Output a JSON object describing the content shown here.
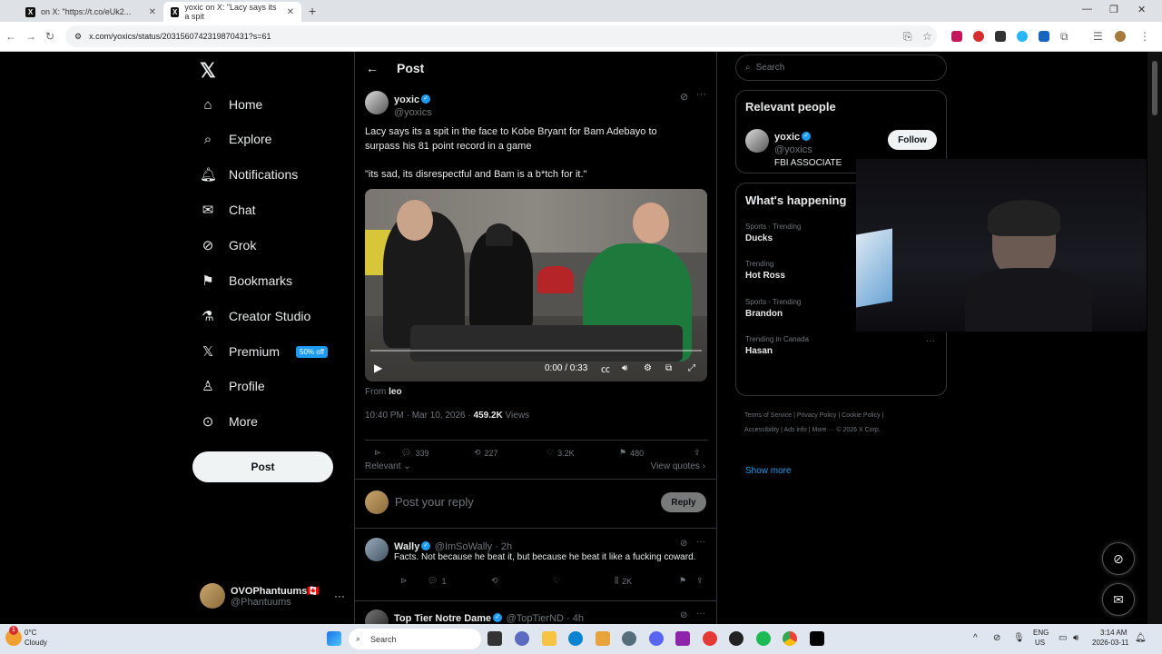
{
  "browser": {
    "tabs": [
      {
        "label": "on X: \"https://t.co/eUk2..."
      },
      {
        "label": "yoxic on X: \"Lacy says its a spit"
      }
    ],
    "url": "x.com/yoxics/status/2031560742319870431?s=61"
  },
  "sidebar": {
    "items": [
      {
        "label": "Home",
        "icon": "home-icon"
      },
      {
        "label": "Explore",
        "icon": "search-icon"
      },
      {
        "label": "Notifications",
        "icon": "bell-icon"
      },
      {
        "label": "Chat",
        "icon": "mail-icon"
      },
      {
        "label": "Grok",
        "icon": "grok-icon"
      },
      {
        "label": "Bookmarks",
        "icon": "bookmark-icon"
      },
      {
        "label": "Creator Studio",
        "icon": "flask-icon"
      },
      {
        "label": "Premium",
        "icon": "x-logo-icon",
        "badge": "50% off"
      },
      {
        "label": "Profile",
        "icon": "person-icon"
      },
      {
        "label": "More",
        "icon": "more-circle-icon"
      }
    ],
    "post_label": "Post",
    "account": {
      "name": "OVOPhantuums🇨🇦",
      "handle": "@Phantuums"
    }
  },
  "main": {
    "header_title": "Post",
    "tweet": {
      "name": "yoxic",
      "handle": "@yoxics",
      "text_line1": "Lacy says its a spit in the face to Kobe Bryant for Bam Adebayo to surpass his 81 point record in a game",
      "text_line2": "\"its sad, its disrespectful and Bam is a b*tch for it.\"",
      "video_time": "0:00 / 0:33",
      "from_label": "From",
      "from_name": "leo",
      "timestamp": "10:40 PM · Mar 10, 2026 · ",
      "views_count": "459.2K",
      "views_label": "Views",
      "replies": "339",
      "reposts": "227",
      "likes": "3.2K",
      "bookmarks": "480"
    },
    "sort_label": "Relevant",
    "view_quotes": "View quotes",
    "reply_placeholder": "Post your reply",
    "reply_button": "Reply",
    "replies": [
      {
        "name": "Wally",
        "handle": "@ImSoWally · 2h",
        "text": "Facts. Not because he beat it, but because he beat it like a fucking coward.",
        "reply_count": "1",
        "views": "2K"
      },
      {
        "name": "Top Tier Notre Dame",
        "handle": "@TopTierND · 4h"
      }
    ]
  },
  "right": {
    "search_placeholder": "Search",
    "relevant_title": "Relevant people",
    "person": {
      "name": "yoxic",
      "handle": "@yoxics",
      "bio": "FBI ASSOCIATE",
      "follow_label": "Follow"
    },
    "happening_title": "What's happening",
    "trends": [
      {
        "meta": "Sports · Trending",
        "name": "Ducks"
      },
      {
        "meta": "Trending",
        "name": "Hot Ross"
      },
      {
        "meta": "Sports · Trending",
        "name": "Brandon"
      },
      {
        "meta": "Trending in Canada",
        "name": "Hasan"
      }
    ],
    "show_more": "Show more",
    "footer": [
      "Terms of Service",
      "|",
      "Privacy Policy",
      "|",
      "Cookie Policy",
      "|",
      "Accessibility",
      "|",
      "Ads info",
      "|",
      "More ···",
      "© 2026 X Corp."
    ]
  },
  "taskbar": {
    "weather_temp": "0°C",
    "weather_desc": "Cloudy",
    "search_label": "Search",
    "lang1": "ENG",
    "lang2": "US",
    "time": "3:14 AM",
    "date": "2026-03-11"
  }
}
